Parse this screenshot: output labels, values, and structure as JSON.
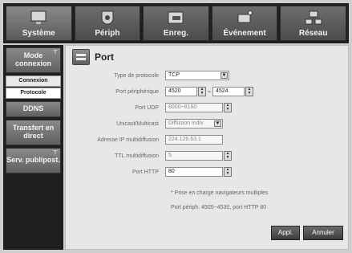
{
  "top_tabs": [
    {
      "label": "Système",
      "icon": "monitor-icon"
    },
    {
      "label": "Périph",
      "icon": "camera-icon"
    },
    {
      "label": "Enreg.",
      "icon": "record-icon"
    },
    {
      "label": "Événement",
      "icon": "event-camera-icon"
    },
    {
      "label": "Réseau",
      "icon": "network-icon"
    }
  ],
  "sidebar": {
    "mode_connexion": "Mode connexion",
    "sub_connexion": "Connexion",
    "sub_protocole": "Protocole",
    "ddns": "DDNS",
    "transfert": "Transfert en direct",
    "serv_publipost": "Serv. publipost."
  },
  "page": {
    "title": "Port"
  },
  "form": {
    "protocol_label": "Type de protocole",
    "protocol_value": "TCP",
    "device_port_label": "Port périphérique",
    "device_port_from": "4520",
    "device_port_to": "4524",
    "udp_label": "Port UDP",
    "udp_value": "8000~8160",
    "cast_label": "Unicast/Multicast",
    "cast_value": "Diffusion indiv",
    "multicast_ip_label": "Adresse IP multidiffusion",
    "multicast_ip_value": "224.126.63.1",
    "ttl_label": "TTL multidiffusion",
    "ttl_value": "5",
    "http_label": "Port HTTP",
    "http_value": "80"
  },
  "notes": {
    "line1": "* Prise en charge navigateurs multiples",
    "line2": "Port périph. 4505~4530, port HTTP 80"
  },
  "buttons": {
    "apply": "Appl.",
    "cancel": "Annuler"
  }
}
